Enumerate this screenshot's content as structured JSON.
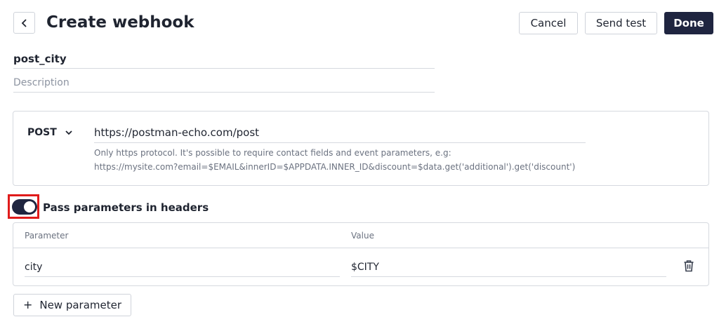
{
  "header": {
    "back_icon": "chevron-left-icon",
    "title": "Create webhook",
    "cancel_label": "Cancel",
    "send_test_label": "Send test",
    "done_label": "Done"
  },
  "form": {
    "name_value": "post_city",
    "description_value": "",
    "description_placeholder": "Description"
  },
  "request": {
    "method": "POST",
    "method_icon": "chevron-down-icon",
    "url_value": "https://postman-echo.com/post",
    "hint_line1": "Only https protocol. It's possible to require contact fields and event parameters, e.g:",
    "hint_line2": "https://mysite.com?email=$EMAIL&innerID=$APPDATA.INNER_ID&discount=$data.get('additional').get('discount')"
  },
  "headers_toggle": {
    "label": "Pass parameters in headers",
    "enabled": true
  },
  "parameters": {
    "columns": [
      "Parameter",
      "Value"
    ],
    "rows": [
      {
        "parameter": "city",
        "value": "$CITY",
        "delete_icon": "trash-icon"
      }
    ],
    "add_label": "New parameter",
    "add_icon": "plus-icon"
  },
  "colors": {
    "primary": "#1f2540",
    "highlight": "#e01b1b",
    "border": "#d6d9df",
    "hint_text": "#6b7280"
  }
}
